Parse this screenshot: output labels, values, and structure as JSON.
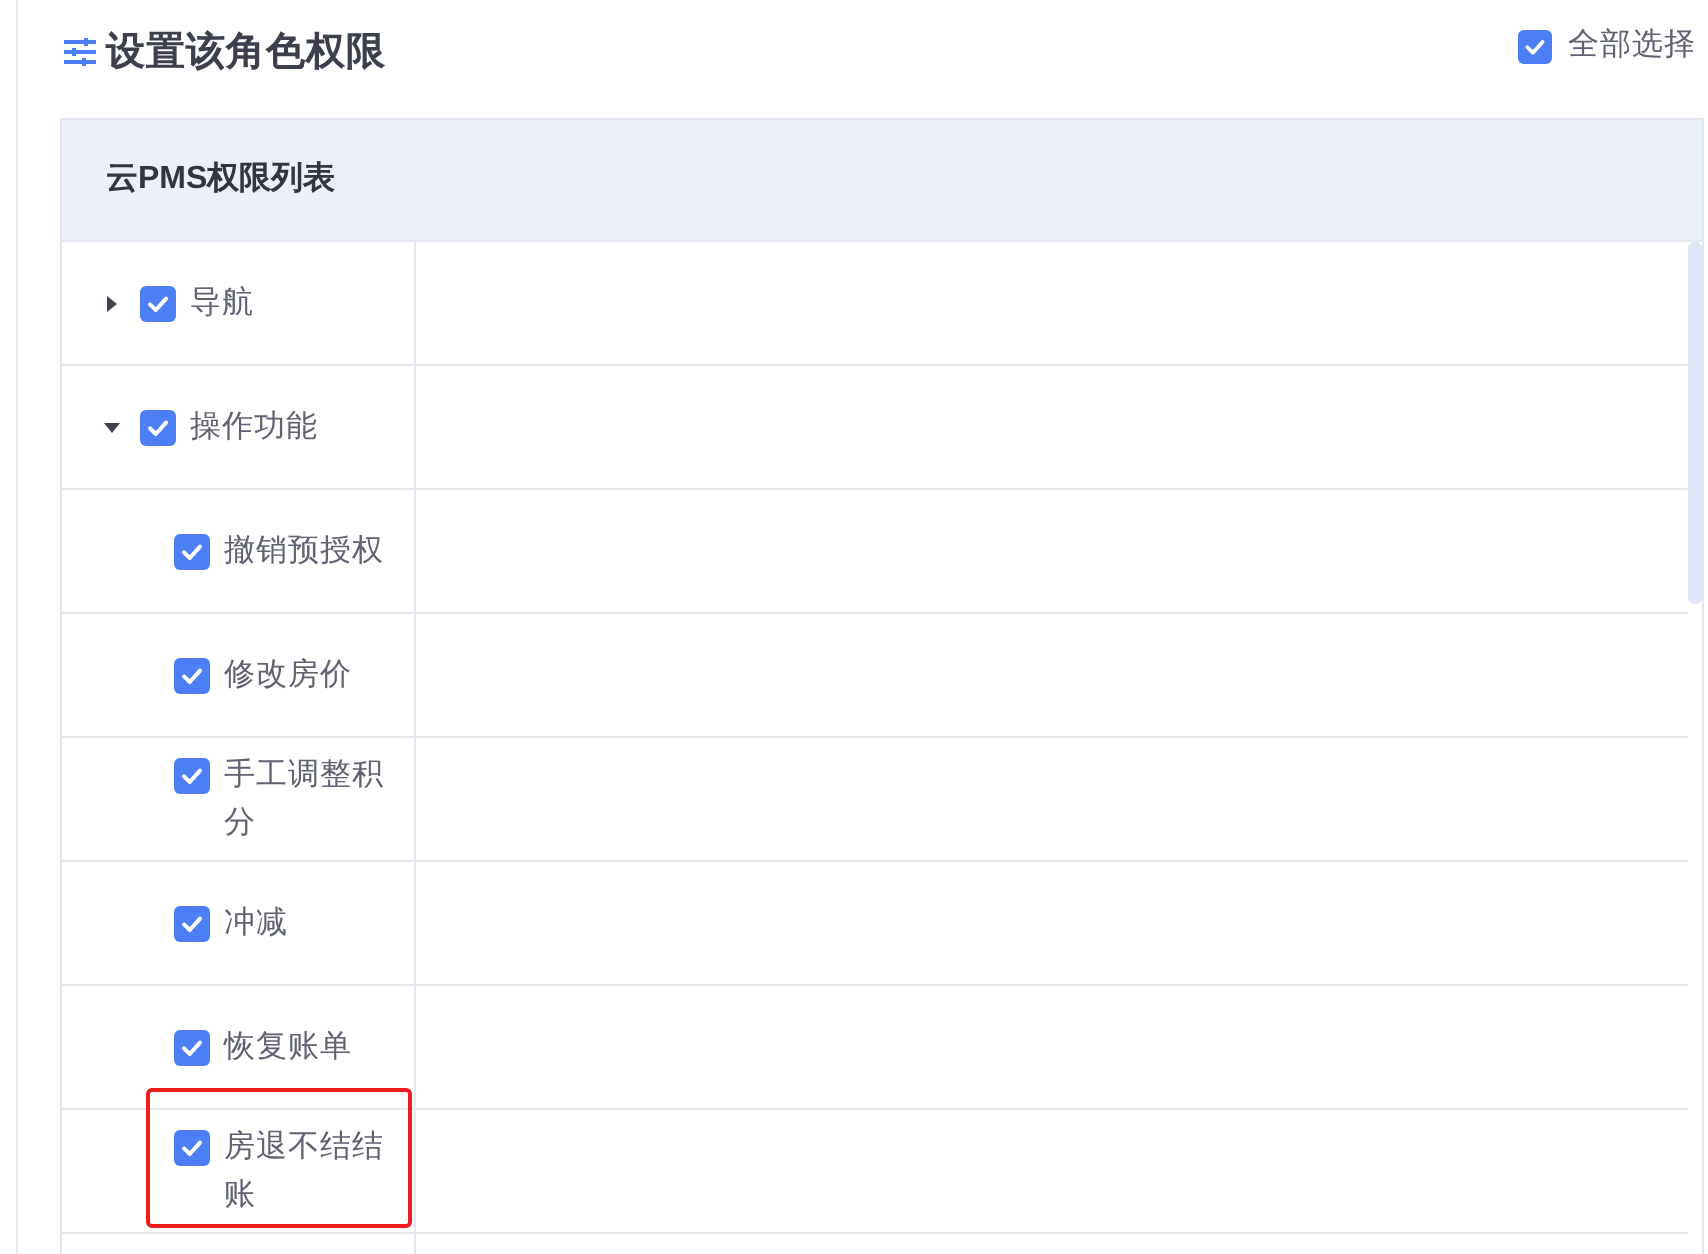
{
  "header": {
    "title": "设置该角色权限",
    "select_all": {
      "label": "全部选择",
      "checked": true
    }
  },
  "panel": {
    "title": "云PMS权限列表"
  },
  "permissions": [
    {
      "label": "导航",
      "checked": true,
      "expanded": false
    },
    {
      "label": "操作功能",
      "checked": true,
      "expanded": true,
      "children": [
        {
          "label": "撤销预授权",
          "checked": true,
          "highlighted": false
        },
        {
          "label": "修改房价",
          "checked": true,
          "highlighted": false
        },
        {
          "label": "手工调整积分",
          "checked": true,
          "highlighted": false
        },
        {
          "label": "冲减",
          "checked": true,
          "highlighted": false
        },
        {
          "label": "恢复账单",
          "checked": true,
          "highlighted": false
        },
        {
          "label": "房退不结结账",
          "checked": true,
          "highlighted": true
        }
      ]
    }
  ]
}
